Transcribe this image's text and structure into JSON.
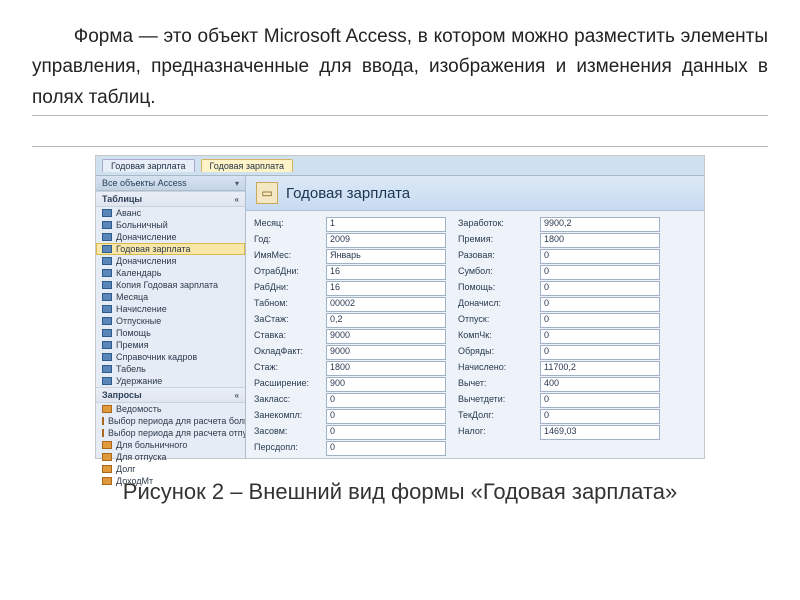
{
  "paragraph": "Форма — это объект Microsoft Access, в котором можно разместить элементы управления, предназначенные для ввода, изображения и изменения данных в полях таблиц.",
  "caption": "Рисунок 2 – Внешний вид формы «Годовая зарплата»",
  "screenshot": {
    "nav_header": "Все объекты Access",
    "section_tables": "Таблицы",
    "section_queries": "Запросы",
    "tables": [
      "Аванс",
      "Больничный",
      "Доначисление",
      "Годовая зарплата",
      "Доначисления",
      "Календарь",
      "Копия Годовая зарплата",
      "Месяца",
      "Начисление",
      "Отпускные",
      "Помощь",
      "Премия",
      "Справочник кадров",
      "Табель",
      "Удержание"
    ],
    "selected_table_index": 3,
    "queries": [
      "Ведомость",
      "Выбор периода для расчета больн...",
      "Выбор периода для расчета отпуска",
      "Для больничного",
      "Для отпуска",
      "Долг",
      "ДоходМт"
    ],
    "tabs": [
      "Годовая зарплата",
      "Годовая зарплата"
    ],
    "active_tab_index": 1,
    "form_title": "Годовая зарплата",
    "fields_left": [
      {
        "label": "Месяц:",
        "value": "1"
      },
      {
        "label": "Год:",
        "value": "2009"
      },
      {
        "label": "ИмяМес:",
        "value": "Январь"
      },
      {
        "label": "ОтрабДни:",
        "value": "16"
      },
      {
        "label": "РабДни:",
        "value": "16"
      },
      {
        "label": "Табном:",
        "value": "00002"
      },
      {
        "label": "ЗаСтаж:",
        "value": "0,2"
      },
      {
        "label": "Ставка:",
        "value": "9000"
      },
      {
        "label": "ОкладФакт:",
        "value": "9000"
      },
      {
        "label": "Стаж:",
        "value": "1800"
      },
      {
        "label": "Расширение:",
        "value": "900"
      },
      {
        "label": "Закласс:",
        "value": "0"
      },
      {
        "label": "Занекомпл:",
        "value": "0"
      },
      {
        "label": "Засовм:",
        "value": "0"
      },
      {
        "label": "Персдопл:",
        "value": "0"
      }
    ],
    "fields_right": [
      {
        "label": "Заработок:",
        "value": "9900,2"
      },
      {
        "label": "Премия:",
        "value": "1800"
      },
      {
        "label": "Разовая:",
        "value": "0"
      },
      {
        "label": "Сумбол:",
        "value": "0"
      },
      {
        "label": "Помощь:",
        "value": "0"
      },
      {
        "label": "Доначисл:",
        "value": "0"
      },
      {
        "label": "Отпуск:",
        "value": "0"
      },
      {
        "label": "КомпЧк:",
        "value": "0"
      },
      {
        "label": "Обряды:",
        "value": "0"
      },
      {
        "label": "Начислено:",
        "value": "11700,2"
      },
      {
        "label": "Вычет:",
        "value": "400"
      },
      {
        "label": "Вычетдети:",
        "value": "0"
      },
      {
        "label": "ТекДолг:",
        "value": "0"
      },
      {
        "label": "Налог:",
        "value": "1469,03"
      }
    ]
  }
}
